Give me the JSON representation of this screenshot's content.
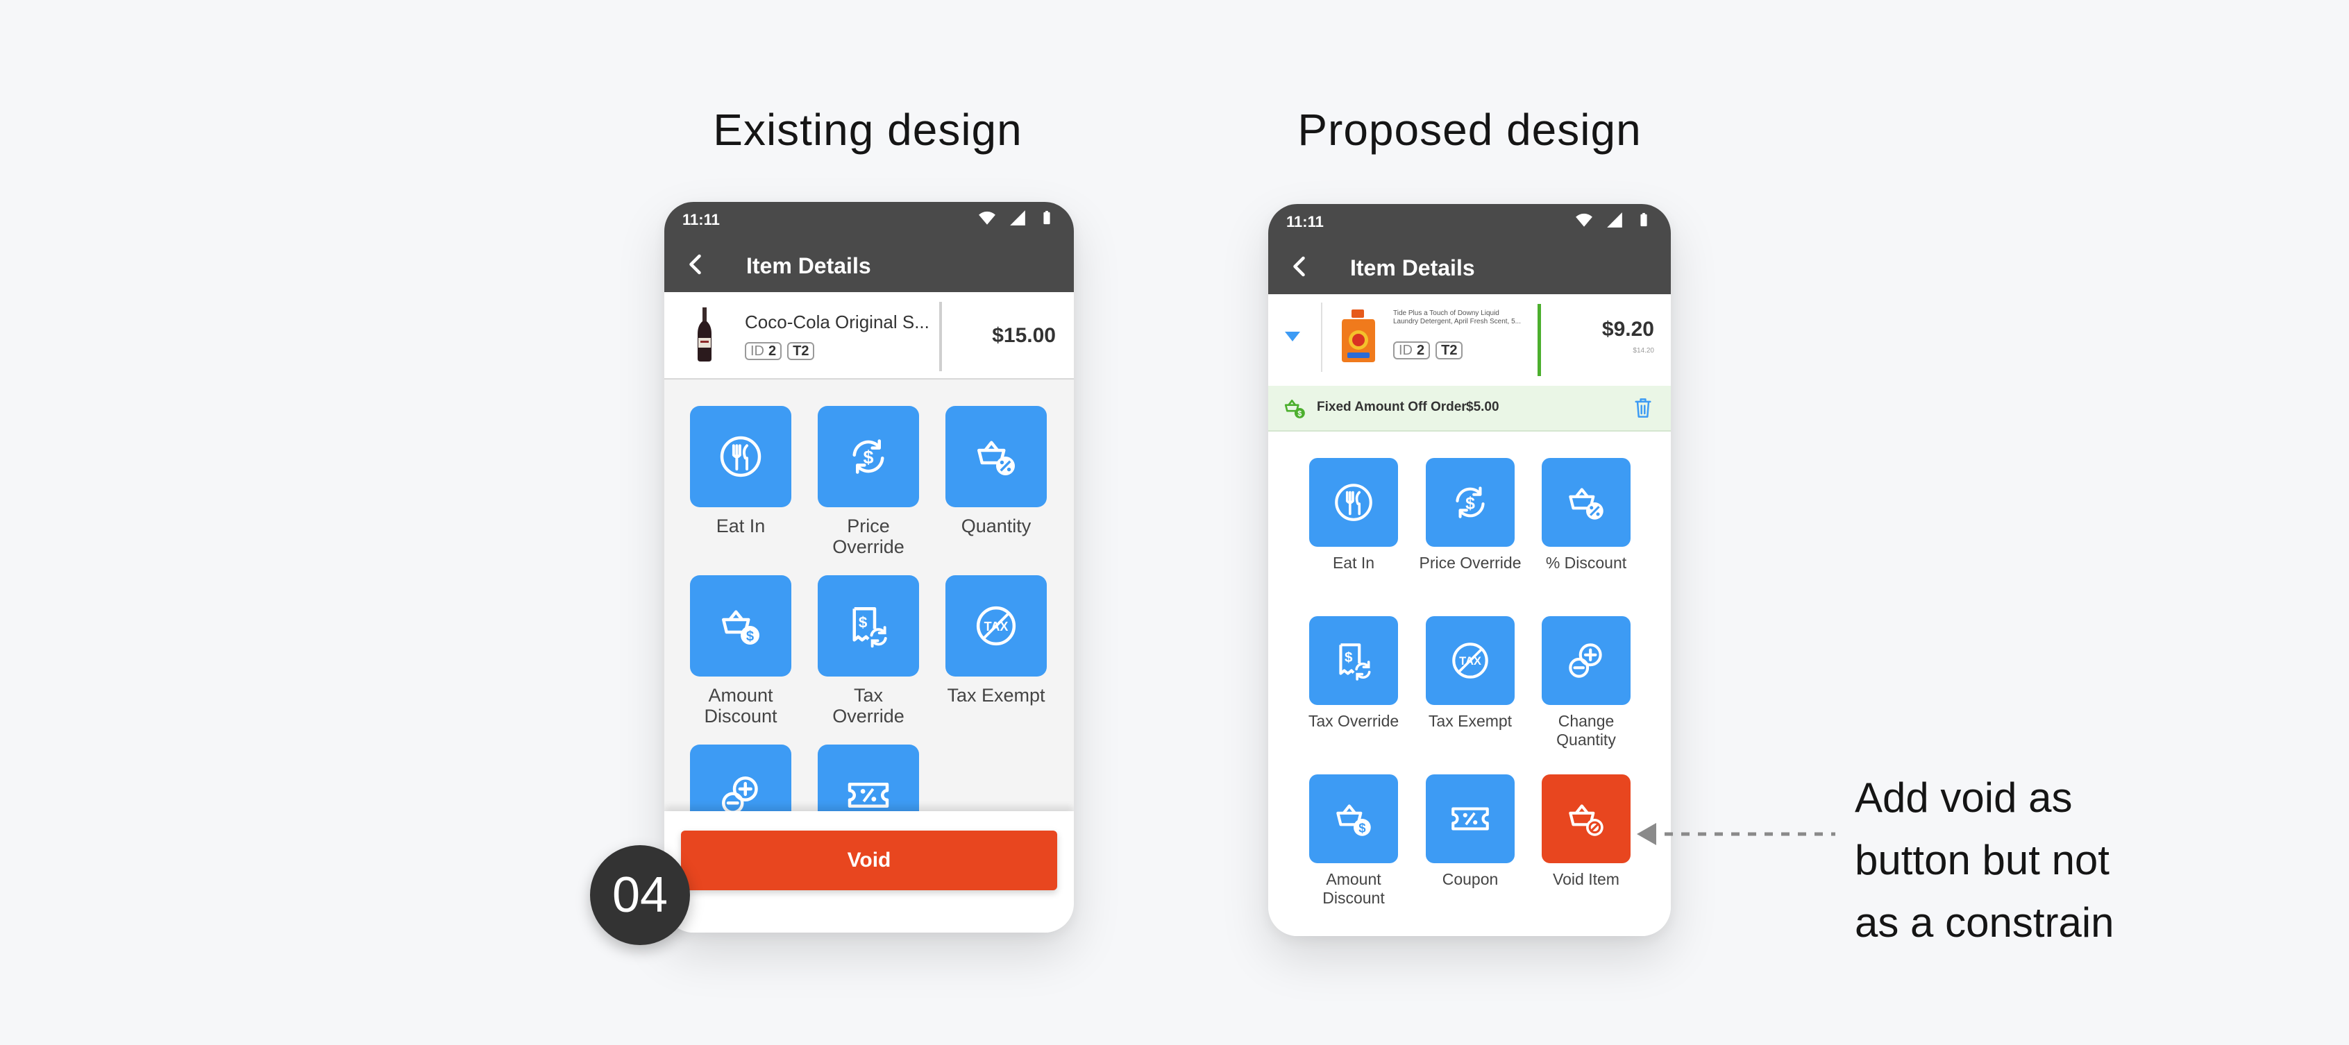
{
  "headings": {
    "existing": "Existing design",
    "proposed": "Proposed design"
  },
  "status_time": "11:11",
  "appbar_title": "Item Details",
  "existing": {
    "item": {
      "name": "Coco-Cola Original S...",
      "id_label": "ID",
      "id_value": "2",
      "tag": "T2",
      "price": "$15.00"
    },
    "tiles": [
      {
        "label": "Eat In",
        "icon": "eat-in-icon"
      },
      {
        "label": "Price Override",
        "icon": "price-override-icon"
      },
      {
        "label": "Quantity",
        "icon": "basket-percent-icon"
      },
      {
        "label": "Amount Discount",
        "icon": "basket-dollar-icon"
      },
      {
        "label": "Tax Override",
        "icon": "tax-override-icon"
      },
      {
        "label": "Tax Exempt",
        "icon": "tax-exempt-icon"
      },
      {
        "label": "",
        "icon": "change-quantity-icon"
      },
      {
        "label": "",
        "icon": "coupon-icon"
      }
    ],
    "void_label": "Void",
    "step": "04"
  },
  "proposed": {
    "item": {
      "name": "Tide Plus a Touch of Downy Liquid Laundry Detergent, April Fresh Scent, 5...",
      "id_label": "ID",
      "id_value": "2",
      "tag": "T2",
      "price": "$9.20",
      "original_price": "$14.20"
    },
    "discount": {
      "label": "Fixed Amount Off Order",
      "amount": "$5.00"
    },
    "tiles": [
      {
        "label": "Eat In",
        "icon": "eat-in-icon"
      },
      {
        "label": "Price Override",
        "icon": "price-override-icon"
      },
      {
        "label": "% Discount",
        "icon": "basket-percent-icon"
      },
      {
        "label": "Tax Override",
        "icon": "tax-override-icon"
      },
      {
        "label": "Tax Exempt",
        "icon": "tax-exempt-icon"
      },
      {
        "label": "Change Quantity",
        "icon": "change-quantity-icon"
      },
      {
        "label": "Amount Discount",
        "icon": "basket-dollar-icon"
      },
      {
        "label": "Coupon",
        "icon": "coupon-icon"
      },
      {
        "label": "Void Item",
        "icon": "void-item-icon"
      }
    ]
  },
  "annotation": [
    "Add void as",
    "button but not",
    "as a constrain"
  ],
  "colors": {
    "tile_blue": "#3d9bf4",
    "void_red": "#e8461f",
    "appbar": "#4a4a4a",
    "accent_green": "#4caf2e"
  }
}
